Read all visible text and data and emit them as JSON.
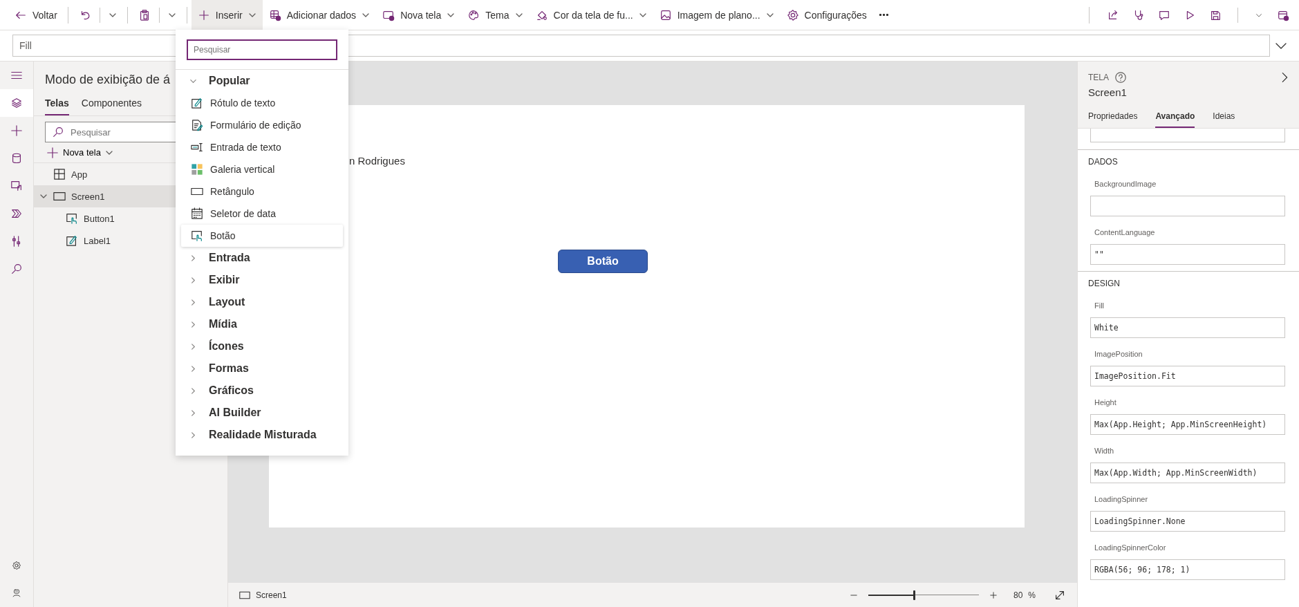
{
  "toolbar": {
    "left": [
      {
        "kind": "back",
        "label": "Voltar",
        "active": false,
        "caret": false
      },
      {
        "kind": "undo",
        "active": false,
        "caret": true
      },
      {
        "kind": "paste",
        "active": false,
        "caret": true
      },
      {
        "kind": "insert",
        "label": "Inserir",
        "active": true,
        "caret": true
      },
      {
        "kind": "data",
        "label": "Adicionar dados",
        "active": false,
        "caret": true
      },
      {
        "kind": "newscreen",
        "label": "Nova tela",
        "active": false,
        "caret": true
      },
      {
        "kind": "theme",
        "label": "Tema",
        "active": false,
        "caret": true
      },
      {
        "kind": "fill",
        "label": "Cor da tela de fu...",
        "active": false,
        "caret": true
      },
      {
        "kind": "image",
        "label": "Imagem de plano...",
        "active": false,
        "caret": true
      },
      {
        "kind": "settings",
        "label": "Configurações",
        "active": false,
        "caret": false
      },
      {
        "kind": "more",
        "active": false,
        "caret": false
      }
    ],
    "right": [
      {
        "kind": "share"
      },
      {
        "kind": "checker"
      },
      {
        "kind": "comment"
      },
      {
        "kind": "play"
      },
      {
        "kind": "save"
      },
      {
        "kind": "caret"
      },
      {
        "kind": "publish"
      }
    ]
  },
  "formula_bar": {
    "property": "Fill"
  },
  "rail": {
    "top": [
      {
        "kind": "menu",
        "selected": false
      },
      {
        "kind": "tree",
        "selected": true
      },
      {
        "kind": "insert",
        "selected": false
      },
      {
        "kind": "data",
        "selected": false
      },
      {
        "kind": "media",
        "selected": false
      },
      {
        "kind": "automate",
        "selected": false
      },
      {
        "kind": "tools",
        "selected": false
      },
      {
        "kind": "search",
        "selected": false
      }
    ],
    "bottom": [
      {
        "kind": "settings",
        "selected": false
      },
      {
        "kind": "agent",
        "selected": false
      }
    ]
  },
  "tree_panel": {
    "title": "Modo de exibição de á",
    "tabs": [
      {
        "label": "Telas",
        "selected": true
      },
      {
        "label": "Componentes",
        "selected": false
      }
    ],
    "search": {
      "placeholder": "Pesquisar"
    },
    "new_screen": "Nova tela",
    "nodes": [
      {
        "label": "App",
        "kind": "app",
        "selected": false
      },
      {
        "label": "Screen1",
        "kind": "screen",
        "selected": true,
        "children": [
          {
            "label": "Button1",
            "kind": "button",
            "selected": false
          },
          {
            "label": "Label1",
            "kind": "label",
            "selected": false
          }
        ]
      }
    ]
  },
  "canvas": {
    "label_text": "n Rodrigues",
    "button": "Botão"
  },
  "status_bar": {
    "screen": "Screen1",
    "zoom": {
      "level": 0.42
    },
    "zoom_value": "80",
    "zoom_unit": "%"
  },
  "insert_menu": {
    "search": {
      "placeholder": "Pesquisar"
    },
    "groups": [
      {
        "label": "Popular",
        "expanded": true,
        "items": [
          {
            "label": "Rótulo de texto",
            "kind": "label",
            "highlighted": false
          },
          {
            "label": "Formulário de edição",
            "kind": "form",
            "highlighted": false
          },
          {
            "label": "Entrada de texto",
            "kind": "textinput",
            "highlighted": false
          },
          {
            "label": "Galeria vertical",
            "kind": "gallery",
            "highlighted": false
          },
          {
            "label": "Retângulo",
            "kind": "rectangle",
            "highlighted": false
          },
          {
            "label": "Seletor de data",
            "kind": "date",
            "highlighted": false
          },
          {
            "label": "Botão",
            "kind": "button",
            "highlighted": true
          }
        ]
      },
      {
        "label": "Entrada",
        "expanded": false
      },
      {
        "label": "Exibir",
        "expanded": false
      },
      {
        "label": "Layout",
        "expanded": false
      },
      {
        "label": "Mídia",
        "expanded": false
      },
      {
        "label": "Ícones",
        "expanded": false
      },
      {
        "label": "Formas",
        "expanded": false
      },
      {
        "label": "Gráficos",
        "expanded": false
      },
      {
        "label": "AI Builder",
        "expanded": false
      },
      {
        "label": "Realidade Misturada",
        "expanded": false
      }
    ]
  },
  "properties_panel": {
    "category": "TELA",
    "name": "Screen1",
    "tabs": [
      {
        "label": "Propriedades",
        "selected": false
      },
      {
        "label": "Avançado",
        "selected": true
      },
      {
        "label": "Ideias",
        "selected": false
      }
    ],
    "sections": [
      {
        "title": "DADOS",
        "props": [
          {
            "name": "BackgroundImage"
          },
          {
            "name": "ContentLanguage",
            "value": "\"\""
          }
        ]
      },
      {
        "title": "DESIGN",
        "props": [
          {
            "name": "Fill",
            "value": "White"
          },
          {
            "name": "ImagePosition",
            "value": "ImagePosition.Fit"
          },
          {
            "name": "Height",
            "value": "Max(App.Height; App.MinScreenHeight)"
          },
          {
            "name": "Width",
            "value": "Max(App.Width; App.MinScreenWidth)"
          },
          {
            "name": "LoadingSpinner",
            "value": "LoadingSpinner.None"
          },
          {
            "name": "LoadingSpinnerColor",
            "value": "RGBA(56; 96; 178; 1)"
          }
        ]
      }
    ]
  }
}
